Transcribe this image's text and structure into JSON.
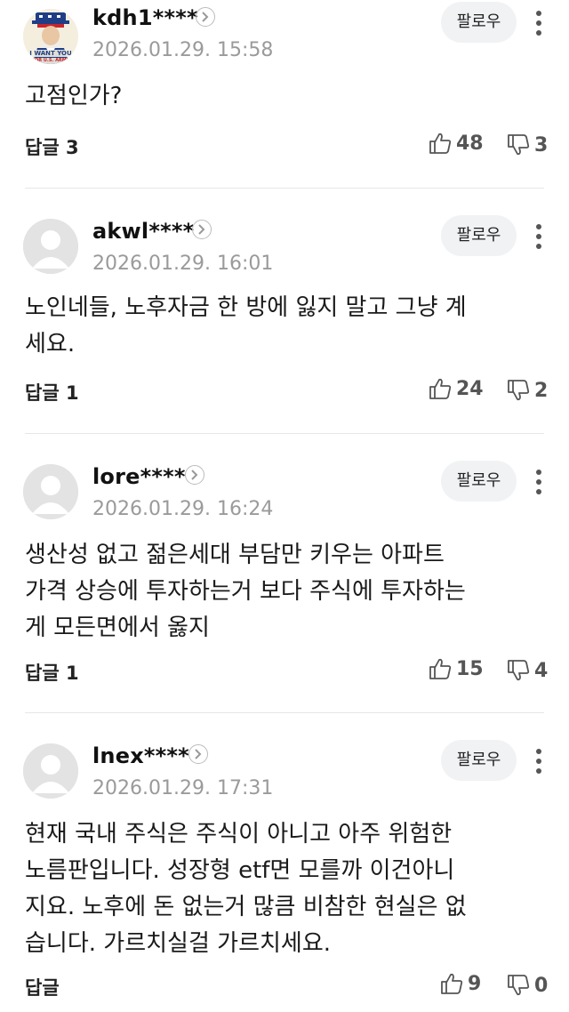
{
  "comments": [
    {
      "username": "kdh1****",
      "date": "2026.01.29. 15:58",
      "follow_label": "팔로우",
      "lines": [
        "고점인가?"
      ],
      "reply_label": "답글 3",
      "likes": "48",
      "dislikes": "3",
      "avatar": "uncle-sam-poster",
      "avatar_text": [
        "I WANT YOU",
        "FOR U.S. ARMY"
      ]
    },
    {
      "username": "akwl****",
      "date": "2026.01.29. 16:01",
      "follow_label": "팔로우",
      "lines": [
        "노인네들, 노후자금 한 방에 잃지 말고 그냥 계",
        "세요."
      ],
      "reply_label": "답글 1",
      "likes": "24",
      "dislikes": "2",
      "avatar": "default-profile"
    },
    {
      "username": "lore****",
      "date": "2026.01.29. 16:24",
      "follow_label": "팔로우",
      "lines": [
        "생산성 없고 젊은세대 부담만 키우는 아파트",
        "가격 상승에 투자하는거 보다 주식에 투자하는",
        "게 모든면에서 옳지"
      ],
      "reply_label": "답글 1",
      "likes": "15",
      "dislikes": "4",
      "avatar": "default-profile"
    },
    {
      "username": "lnex****",
      "date": "2026.01.29. 17:31",
      "follow_label": "팔로우",
      "lines": [
        "현재 국내 주식은 주식이 아니고 아주 위험한",
        "노름판입니다. 성장형 etf면 모를까 이건아니",
        "지요. 노후에 돈 없는거 많큼 비참한 현실은 없",
        "습니다. 가르치실걸 가르치세요."
      ],
      "reply_label": "답글",
      "likes": "9",
      "dislikes": "0",
      "avatar": "default-profile"
    }
  ],
  "icons": {
    "like": "thumbs-up-outline-icon",
    "dislike": "thumbs-down-outline-icon",
    "more": "vertical-ellipsis-icon",
    "profile_link": "chevron-right-circle-icon"
  },
  "colors": {
    "text": "#111111",
    "meta": "#9a9a9a",
    "follow_bg": "#f1f2f4",
    "divider": "#e6e6e6",
    "icon": "#555555"
  }
}
